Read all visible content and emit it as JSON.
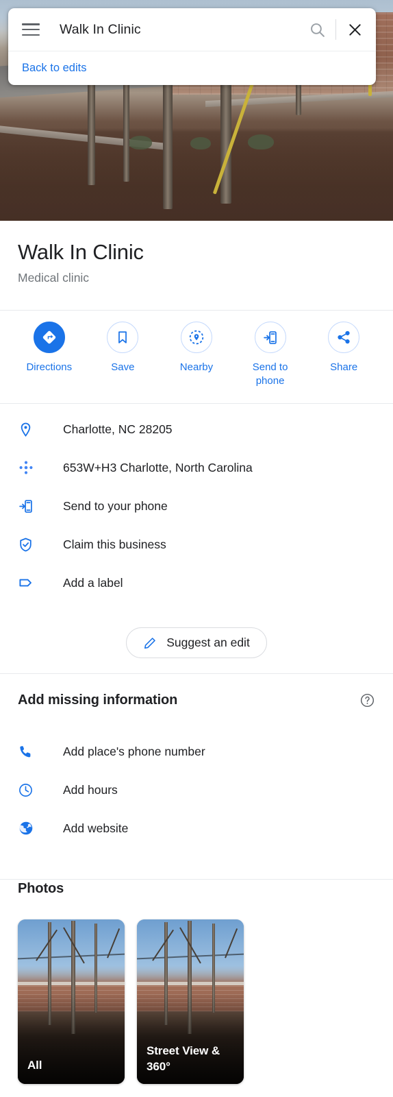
{
  "search": {
    "menu_icon": "hamburger-icon",
    "query": "Walk In Clinic",
    "search_icon": "search-icon",
    "close_icon": "close-icon",
    "back_link": "Back to edits"
  },
  "place": {
    "title": "Walk In Clinic",
    "category": "Medical clinic"
  },
  "actions": [
    {
      "label": "Directions",
      "icon": "directions-icon",
      "filled": true
    },
    {
      "label": "Save",
      "icon": "bookmark-icon",
      "filled": false
    },
    {
      "label": "Nearby",
      "icon": "nearby-pin-icon",
      "filled": false
    },
    {
      "label": "Send to phone",
      "icon": "send-to-phone-icon",
      "filled": false
    },
    {
      "label": "Share",
      "icon": "share-icon",
      "filled": false
    }
  ],
  "info_rows": [
    {
      "label": "Charlotte, NC 28205",
      "icon": "location-pin-icon"
    },
    {
      "label": "653W+H3 Charlotte, North Carolina",
      "icon": "plus-code-icon"
    },
    {
      "label": "Send to your phone",
      "icon": "send-to-phone-icon"
    },
    {
      "label": "Claim this business",
      "icon": "shield-check-icon"
    },
    {
      "label": "Add a label",
      "icon": "label-tag-icon"
    }
  ],
  "suggest_edit": {
    "label": "Suggest an edit",
    "icon": "pencil-icon"
  },
  "missing_info": {
    "title": "Add missing information",
    "help_icon": "help-circle-icon",
    "rows": [
      {
        "label": "Add place's phone number",
        "icon": "phone-icon"
      },
      {
        "label": "Add hours",
        "icon": "clock-icon"
      },
      {
        "label": "Add website",
        "icon": "globe-icon"
      }
    ]
  },
  "photos": {
    "title": "Photos",
    "items": [
      {
        "label": "All"
      },
      {
        "label": "Street View & 360°"
      }
    ]
  },
  "colors": {
    "accent_blue": "#1a73e8",
    "text_primary": "#202124",
    "text_secondary": "#70757a",
    "divider": "#e8eaed"
  }
}
